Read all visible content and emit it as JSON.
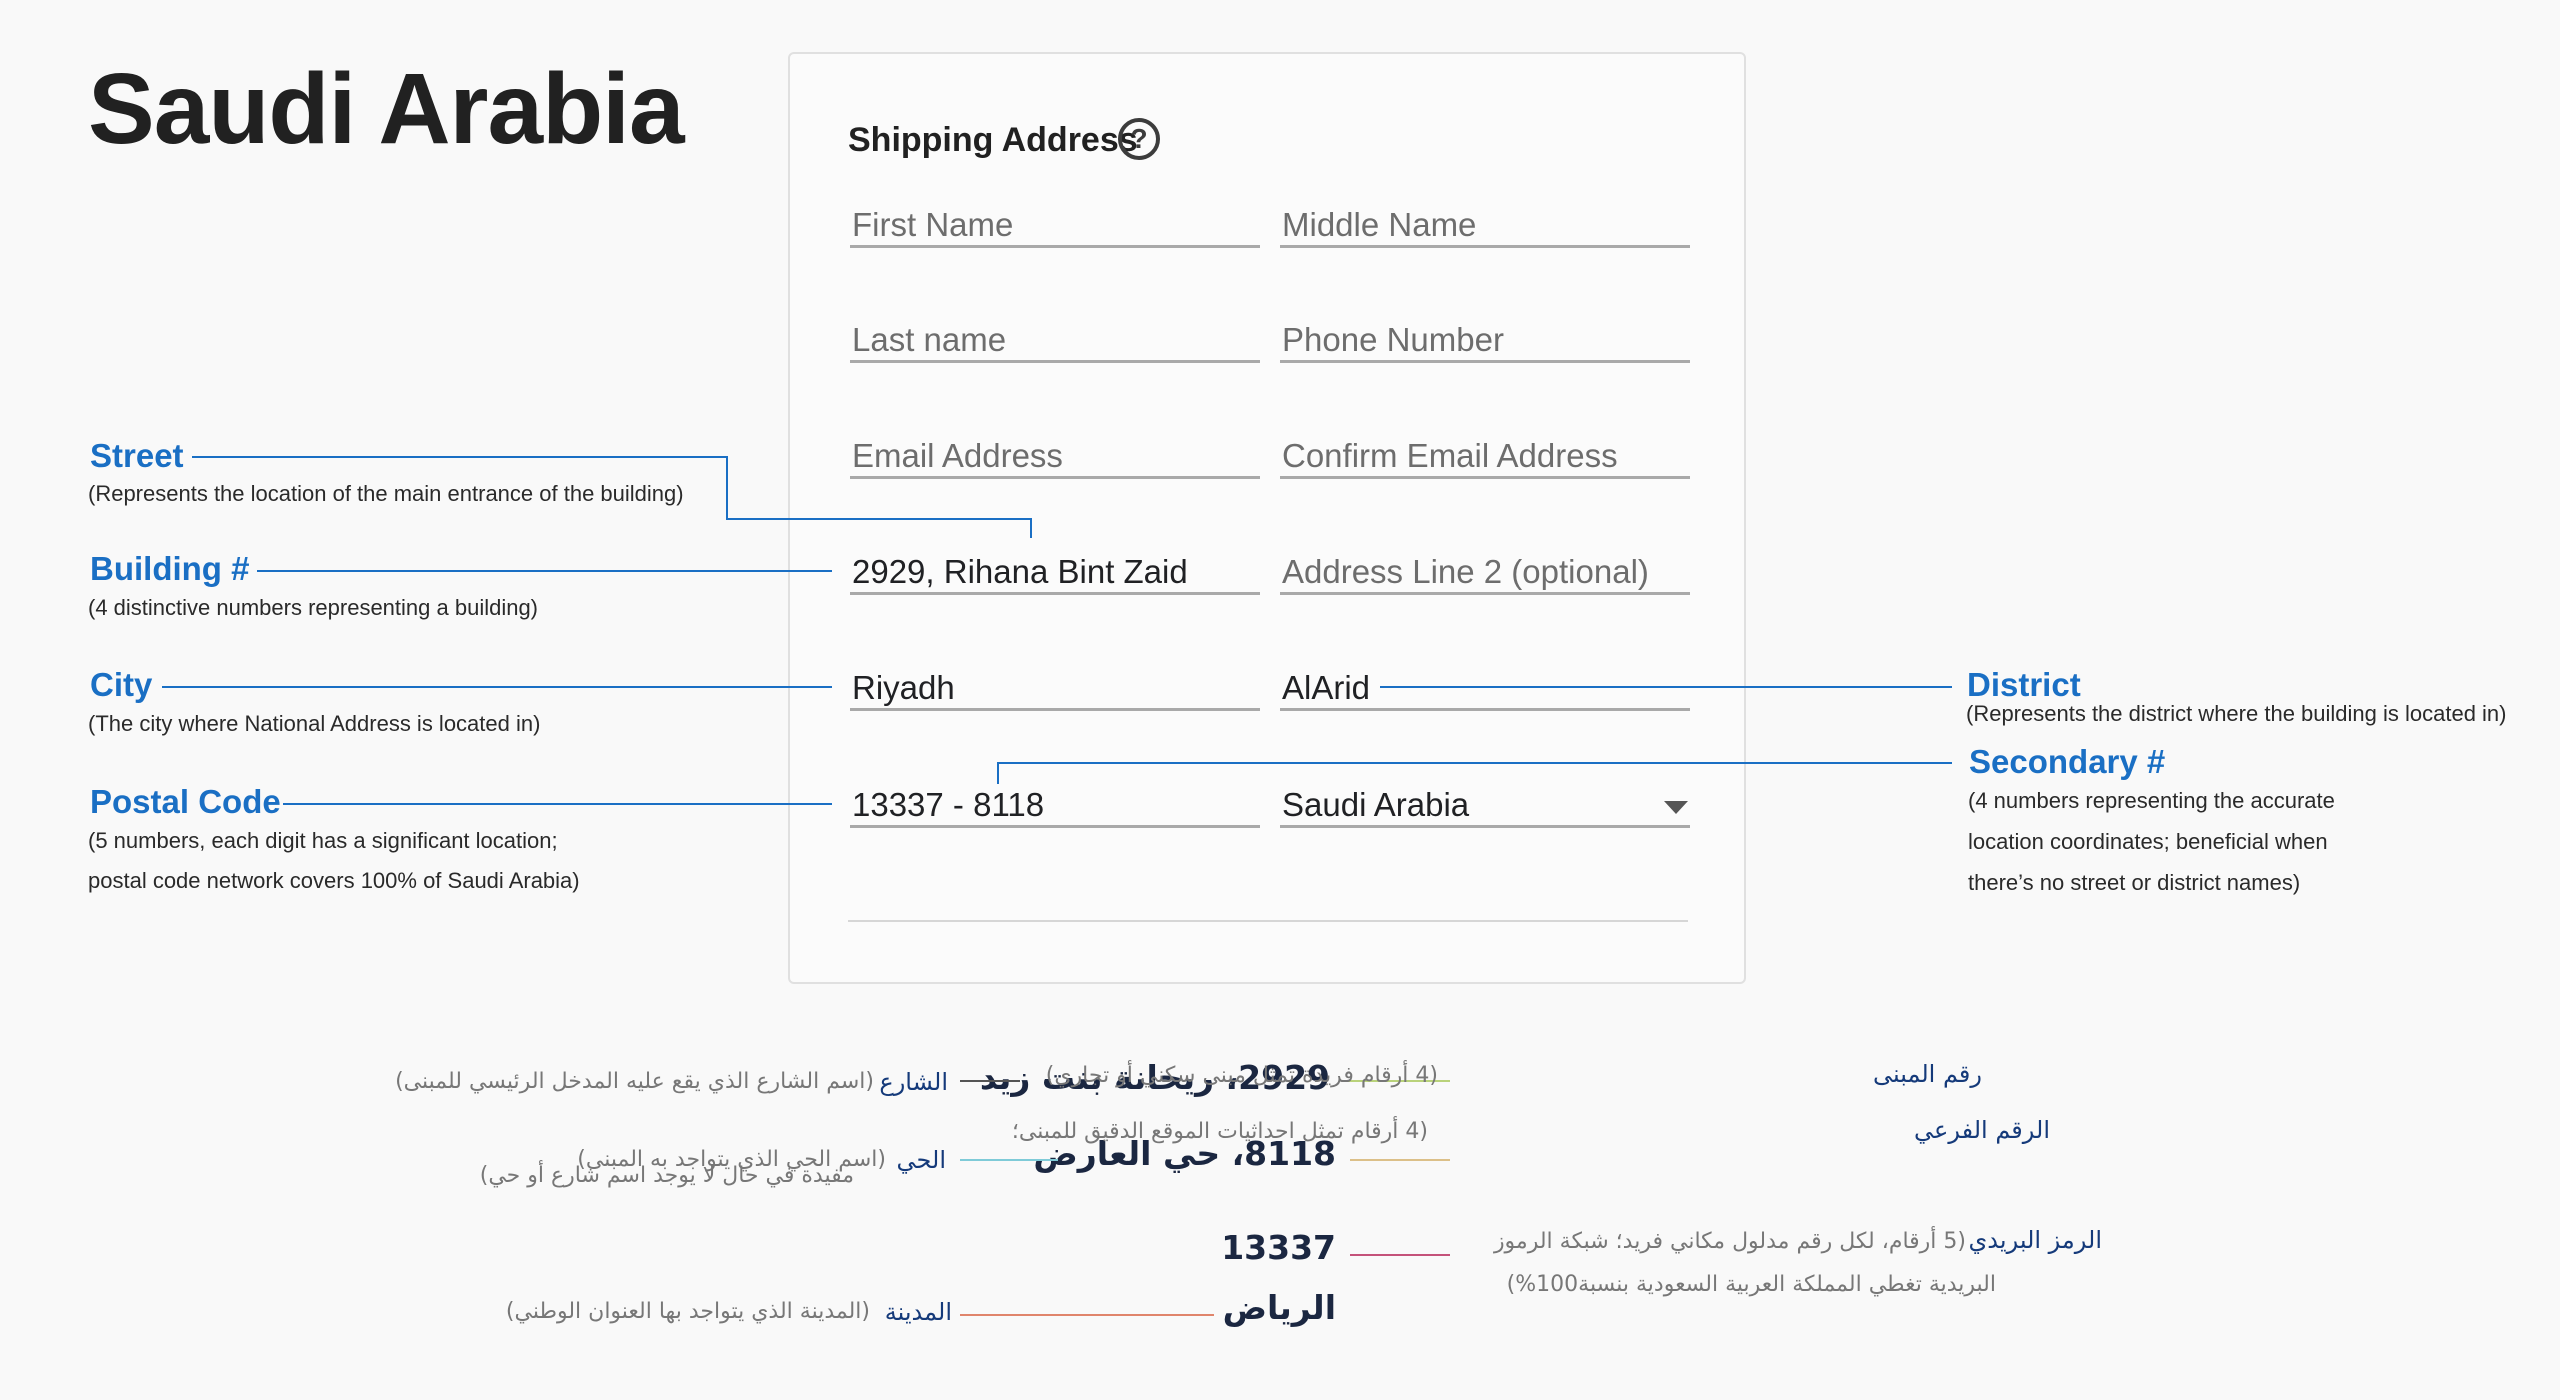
{
  "page": {
    "title": "Saudi Arabia"
  },
  "form": {
    "heading": "Shipping Address",
    "help_icon": "?",
    "fields": {
      "first_name": {
        "placeholder": "First Name",
        "value": ""
      },
      "middle_name": {
        "placeholder": "Middle Name",
        "value": ""
      },
      "last_name": {
        "placeholder": "Last name",
        "value": ""
      },
      "phone": {
        "placeholder": "Phone Number",
        "value": ""
      },
      "email": {
        "placeholder": "Email Address",
        "value": ""
      },
      "confirm_email": {
        "placeholder": "Confirm Email Address",
        "value": ""
      },
      "address1": {
        "placeholder": "",
        "value": "2929, Rihana Bint Zaid"
      },
      "address2": {
        "placeholder": "Address Line 2 (optional)",
        "value": ""
      },
      "city": {
        "placeholder": "",
        "value": "Riyadh"
      },
      "district": {
        "placeholder": "",
        "value": "AlArid"
      },
      "postal": {
        "placeholder": "",
        "value": "13337 - 8118"
      },
      "country": {
        "value": "Saudi Arabia"
      }
    }
  },
  "annotations": {
    "street": {
      "title": "Street",
      "desc": "(Represents the location of the main entrance of the building)"
    },
    "building": {
      "title": "Building #",
      "desc": "(4 distinctive numbers representing a building)"
    },
    "city": {
      "title": "City",
      "desc": "(The city where National Address is located in)"
    },
    "postal": {
      "title": "Postal Code",
      "desc1": "(5 numbers, each digit has a significant location;",
      "desc2": "postal code network covers 100% of Saudi Arabia)"
    },
    "district": {
      "title": "District",
      "desc": "(Represents the district where the building is located in)"
    },
    "secondary": {
      "title": "Secondary #",
      "desc1": "(4 numbers representing the accurate",
      "desc2": "location coordinates; beneficial when",
      "desc3": "there’s no street or district names)"
    }
  },
  "arabic": {
    "row1": {
      "main": "2929، ريحانة بنت زيد",
      "left_key": "الشارع",
      "left_desc": "(اسم الشارع الذي يقع عليه المدخل الرئيسي للمبنى)",
      "right_key": "رقم المبنى",
      "right_desc": "(4 أرقام فريدة تمثل مبنى سكني أو تجاري)"
    },
    "row2": {
      "main": "8118، حي العارض",
      "left_key": "الحي",
      "left_desc": "(اسم الحي الذي يتواجد به المبنى)",
      "right_key": "الرقم الفرعي",
      "right_desc1": "(4 أرقام تمثل احداثيات الموقع الدقيق للمبنى؛",
      "right_desc2": "مفيدة في حال لا يوجد اسم شارع أو حي)"
    },
    "row3": {
      "main": "13337",
      "right_key": "الرمز البريدي",
      "right_desc1": "(5 أرقام، لكل رقم مدلول مكاني فريد؛ شبكة الرموز",
      "right_desc2": "البريدية تغطي المملكة العربية السعودية بنسبة100%)"
    },
    "row4": {
      "main": "الرياض",
      "left_key": "المدينة",
      "left_desc": "(المدينة الذي يتواجد بها العنوان الوطني)"
    }
  },
  "colors": {
    "accent": "#1a6fc4",
    "row1_line": "#b9d27a",
    "row2_left_line": "#7fcbd8",
    "row2_right_line": "#dcc089",
    "row3_line": "#c4527a",
    "row4_line": "#e0856c"
  }
}
